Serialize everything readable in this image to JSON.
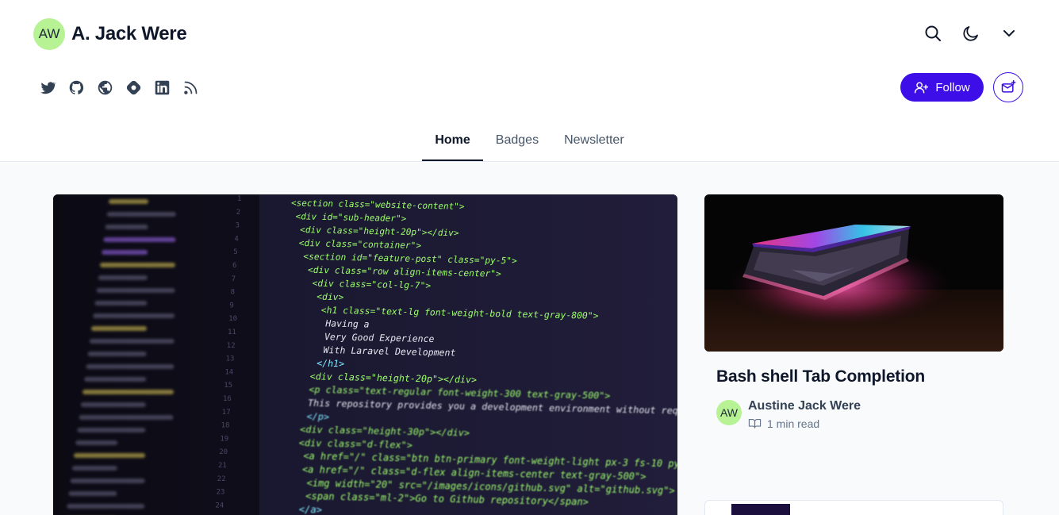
{
  "blog": {
    "avatar_initials": "AW",
    "name": "A. Jack Were"
  },
  "header_icons": [
    "search-icon",
    "moon-icon",
    "chevron-down-icon"
  ],
  "socials": [
    "twitter-icon",
    "github-icon",
    "globe-icon",
    "hashnode-icon",
    "linkedin-icon",
    "rss-icon"
  ],
  "follow_label": "Follow",
  "tabs": [
    {
      "label": "Home",
      "active": true
    },
    {
      "label": "Badges",
      "active": false
    },
    {
      "label": "Newsletter",
      "active": false
    }
  ],
  "featured_post": {
    "image": "code-editor-screenshot",
    "code_lines": [
      "<section class=\"website-content\">",
      "<div id=\"sub-header\">",
      "<div class=\"height-20p\"></div>",
      "<div class=\"container\">",
      "<section id=\"feature-post\" class=\"py-5\">",
      "<div class=\"row align-items-center\">",
      "<div class=\"col-lg-7\">",
      "<div>",
      "<h1 class=\"text-lg font-weight-bold text-gray-800\">",
      "Having a",
      "Very Good Experience",
      "With Laravel Development",
      "</h1>",
      "<div class=\"height-20p\"></div>",
      "<p class=\"text-regular font-weight-300 text-gray-500\">",
      "This repository provides you a development environment without requ",
      "</p>",
      "<div class=\"height-30p\"></div>",
      "<div class=\"d-flex\">",
      "<a href=\"/\" class=\"btn btn-primary font-weight-light px-3 fs-10 py\">",
      "<a href=\"/\" class=\"d-flex align-items-center text-gray-500\">",
      "<img width=\"20\" src=\"/images/icons/github.svg\" alt=\"github.svg\">",
      "<span class=\"ml-2\">Go to Github repository</span>",
      "</a>"
    ]
  },
  "side_post": {
    "image": "laptop-glow-photo",
    "title": "Bash shell Tab Completion",
    "author_initials": "AW",
    "author_name": "Austine Jack Were",
    "read_time": "1 min read"
  },
  "colors": {
    "primary": "#3d0ee8",
    "avatar_bg": "#b7f294",
    "page_bg": "#f8fafc"
  }
}
